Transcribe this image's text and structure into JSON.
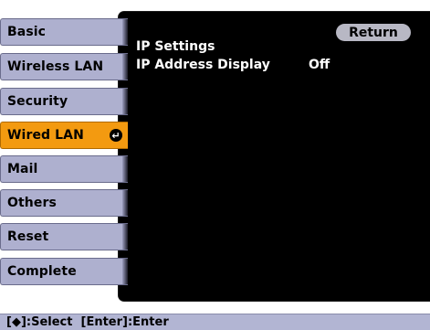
{
  "sidebar": {
    "items": [
      {
        "label": "Basic"
      },
      {
        "label": "Wireless LAN"
      },
      {
        "label": "Security"
      },
      {
        "label": "Wired LAN",
        "selected": true
      },
      {
        "label": "Mail"
      },
      {
        "label": "Others"
      },
      {
        "label": "Reset"
      },
      {
        "label": "Complete"
      }
    ],
    "enter_icon_glyph": "↵"
  },
  "main": {
    "return_label": "Return",
    "rows": [
      {
        "label": "IP Settings",
        "value": ""
      },
      {
        "label": "IP Address Display",
        "value": "Off"
      }
    ]
  },
  "helpbar": {
    "text": "[◆]:Select  [Enter]:Enter"
  },
  "colors": {
    "tab_bg": "#aeb0cf",
    "tab_selected_bg": "#f39a10",
    "panel_bg": "#000000",
    "helpbar_bg": "#b2b5d3"
  }
}
